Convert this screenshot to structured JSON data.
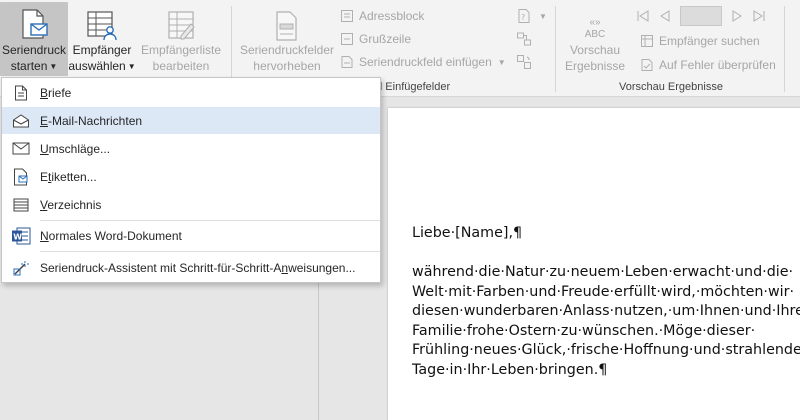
{
  "ribbon": {
    "start_mail_merge": {
      "line1": "Seriendruck",
      "line2": "starten"
    },
    "select_recipients": {
      "line1": "Empfänger",
      "line2": "auswählen"
    },
    "edit_recipient_list": {
      "line1": "Empfängerliste",
      "line2": "bearbeiten"
    },
    "highlight_merge_fields": {
      "line1": "Seriendruckfelder",
      "line2": "hervorheben"
    },
    "address_block": "Adressblock",
    "greeting_line": "Grußzeile",
    "insert_merge_field": "Seriendruckfeld einfügen",
    "preview_results": {
      "line1": "Vorschau",
      "line2": "Ergebnisse",
      "icon_text": "ABC"
    },
    "find_recipient": "Empfänger suchen",
    "check_errors": "Auf Fehler überprüfen",
    "group_write_insert": "nd Einfügefelder",
    "group_preview": "Vorschau Ergebnisse"
  },
  "menu": {
    "items": [
      {
        "pre": "",
        "key": "B",
        "post": "riefe",
        "icon": "document-icon"
      },
      {
        "pre": "",
        "key": "E",
        "post": "-Mail-Nachrichten",
        "icon": "email-envelope-icon"
      },
      {
        "pre": "",
        "key": "U",
        "post": "mschläge...",
        "icon": "envelope-icon"
      },
      {
        "pre": "E",
        "key": "t",
        "post": "iketten...",
        "icon": "labels-icon"
      },
      {
        "pre": "",
        "key": "V",
        "post": "erzeichnis",
        "icon": "directory-icon"
      },
      {
        "pre": "",
        "key": "N",
        "post": "ormales Word-Dokument",
        "icon": "word-document-icon"
      },
      {
        "pre": "Seriendruck-Assistent mit Schritt-für-Schritt-A",
        "key": "n",
        "post": "weisungen...",
        "icon": "wizard-icon"
      }
    ]
  },
  "document": {
    "lines": [
      "Liebe·[Name],¶",
      "",
      "während·die·Natur·zu·neuem·Leben·erwacht·und·die·",
      "Welt·mit·Farben·und·Freude·erfüllt·wird,·möchten·wir·",
      "diesen·wunderbaren·Anlass·nutzen,·um·Ihnen·und·Ihrer·",
      "Familie·frohe·Ostern·zu·wünschen.·Möge·dieser·",
      "Frühling·neues·Glück,·frische·Hoffnung·und·strahlende·",
      "Tage·in·Ihr·Leben·bringen.¶"
    ]
  },
  "colors": {
    "menu_hover": "#dce8f6",
    "accent_blue": "#2b579a"
  }
}
